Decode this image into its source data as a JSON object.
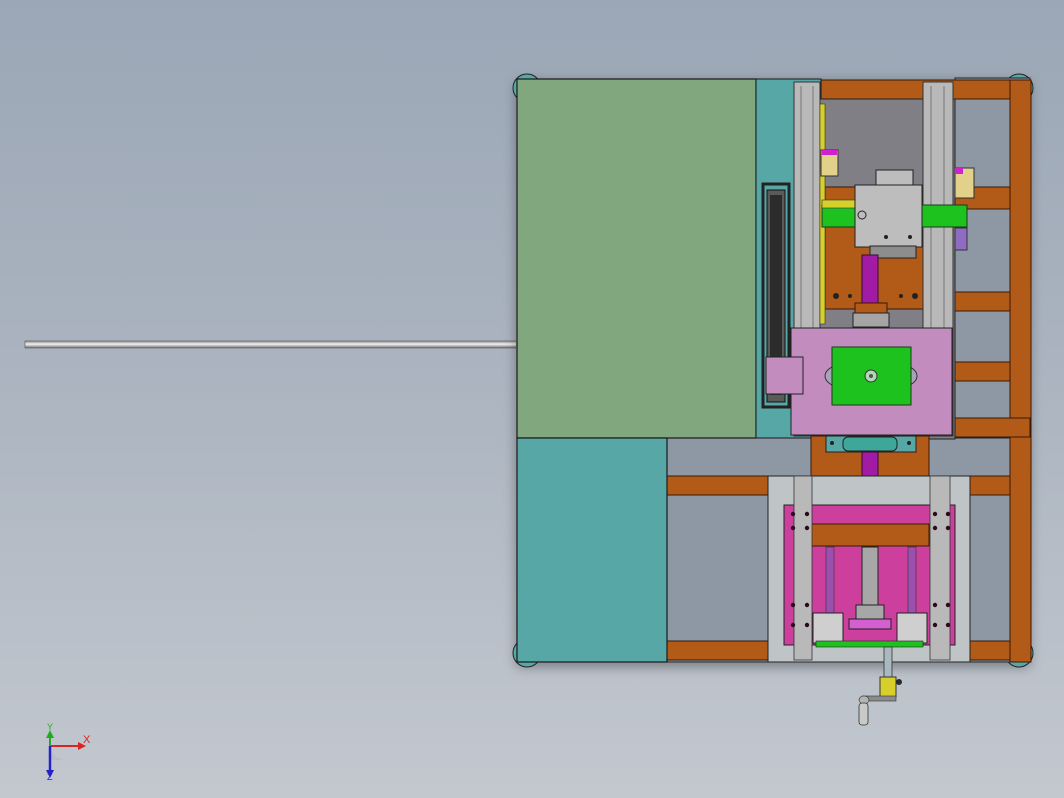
{
  "view": {
    "background_top": "#9ba7b6",
    "background_bottom": "#c3c8cf"
  },
  "colors": {
    "frame_orange": "#b25a17",
    "green_panel": "#80a77d",
    "teal_panel": "#56a7a6",
    "rail_gray": "#b9b9b9",
    "pink_block": "#c28cbf",
    "green_block": "#1ec21e",
    "magenta_plate": "#cc3f9d",
    "purple_screw": "#a21ba4",
    "yellow_part": "#d7cf2a",
    "rod_silver": "#c8c8c8"
  },
  "axis_triad": {
    "x_label": "X",
    "y_label": "Y",
    "z_label": "Z"
  }
}
